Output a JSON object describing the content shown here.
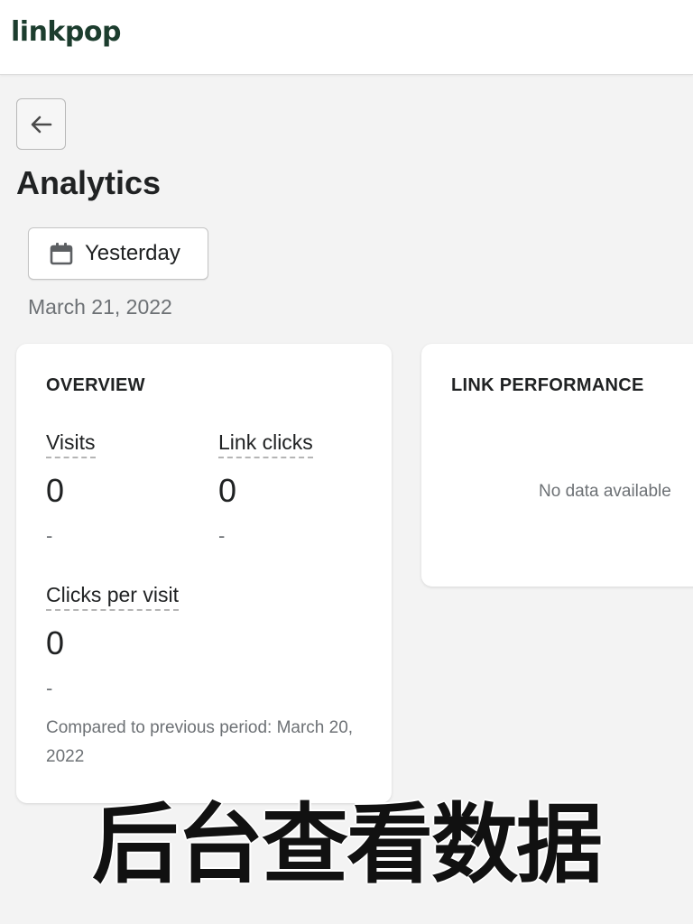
{
  "header": {
    "logo_text": "linkpop",
    "brand_color": "#1c3d2e"
  },
  "page": {
    "back_icon": "arrow-left-icon",
    "title": "Analytics"
  },
  "date_filter": {
    "icon": "calendar-icon",
    "label": "Yesterday",
    "date": "March 21, 2022"
  },
  "overview": {
    "heading": "OVERVIEW",
    "visits": {
      "label": "Visits",
      "value": "0",
      "change": "-"
    },
    "link_clicks": {
      "label": "Link clicks",
      "value": "0",
      "change": "-"
    },
    "clicks_per_visit": {
      "label": "Clicks per visit",
      "value": "0",
      "change": "-"
    },
    "comparison": "Compared to previous period: March 20, 2022"
  },
  "link_performance": {
    "heading": "LINK PERFORMANCE",
    "empty_text": "No data available"
  },
  "overlay": {
    "caption": "后台查看数据"
  }
}
